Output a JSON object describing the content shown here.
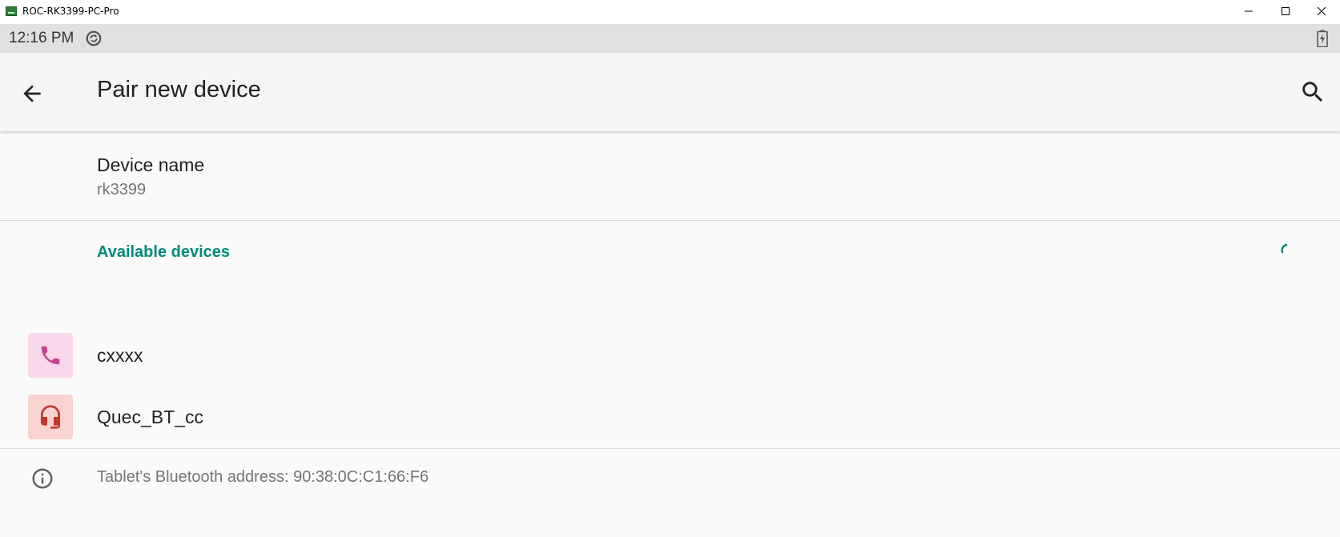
{
  "window": {
    "title": "ROC-RK3399-PC-Pro",
    "icon": "app-icon",
    "controls": [
      "minimize-icon",
      "maximize-icon",
      "close-icon"
    ]
  },
  "status_bar": {
    "time": "12:16 PM",
    "icons": [
      "sync-icon",
      "battery-charging-icon"
    ]
  },
  "app_bar": {
    "title": "Pair new device",
    "back_icon": "arrow-back-icon",
    "search_icon": "search-icon"
  },
  "device_name": {
    "label": "Device name",
    "value": "rk3399"
  },
  "available": {
    "header": "Available devices",
    "accent_color": "#00897b",
    "devices": [
      {
        "name": "cxxxx",
        "icon": "phone-icon",
        "icon_bg": "#f8d7ea",
        "icon_color": "#c2448f"
      },
      {
        "name": "Quec_BT_cc",
        "icon": "headset-icon",
        "icon_bg": "#f9d3d0",
        "icon_color": "#c0392b"
      }
    ]
  },
  "footer": {
    "address_text": "Tablet's Bluetooth address: 90:38:0C:C1:66:F6",
    "icon": "info-icon"
  }
}
